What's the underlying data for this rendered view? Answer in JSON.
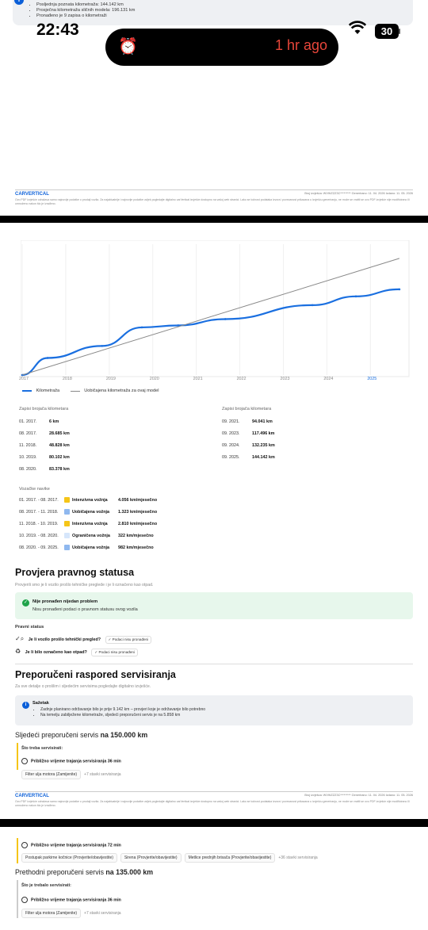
{
  "status_bar": {
    "time": "22:43",
    "activity": "1 hr ago",
    "battery": "30"
  },
  "top_info": {
    "items": [
      "Posljednja poznata kilometraža: 144.142 km",
      "Prosječna kilometraža sličnih modela: 196.131 km",
      "Pronađeno je 9 zapisa o kilometraži"
    ]
  },
  "footer": {
    "logo": "CARVERTICAL",
    "meta": "Broj izvješća: WVWZZZ3C*********     Generirano: 11. 04. 2026     Izdano: 11. 05. 2026",
    "disclaimer": "Ovo PDF izvješće odražava samo najnovije podatke o prodaji vozila. Za najaktualnije i najnovije podatke uvijek pogledajte digitalno carVertical izvješće dostupno na vašoj web stranici. Lako se točnost podataka izvora i povezanost prikazana u izvješću generiranju, ne može se vratiti se ovo PDF izvješće nije modificirano ili umnoženo nakon što je izrađeno."
  },
  "chart_data": {
    "type": "line",
    "x_ticks": [
      "2017",
      "2018",
      "2019",
      "2020",
      "2021",
      "2022",
      "2023",
      "2024",
      "2025"
    ],
    "highlighted_tick": "2025",
    "series": [
      {
        "name": "Kilometraža",
        "color": "#1a6fe0",
        "x": [
          "01. 2017.",
          "08. 2017.",
          "11. 2018.",
          "10. 2019.",
          "08. 2020.",
          "09. 2021.",
          "09. 2023.",
          "09. 2024.",
          "09. 2025."
        ],
        "values": [
          6,
          28685,
          48828,
          80102,
          83378,
          94041,
          117496,
          132235,
          144142
        ]
      },
      {
        "name": "Uobičajena kilometraža za ovaj model",
        "color": "#888888",
        "x": [
          "01. 2017.",
          "09. 2025."
        ],
        "values": [
          0,
          196131
        ]
      }
    ],
    "ylim": [
      0,
      220000
    ]
  },
  "odometer": {
    "title": "Zapisi brojača kilometara",
    "left": [
      {
        "date": "01. 2017.",
        "km": "6 km"
      },
      {
        "date": "08. 2017.",
        "km": "28.685 km"
      },
      {
        "date": "11. 2018.",
        "km": "48.828 km"
      },
      {
        "date": "10. 2019.",
        "km": "80.102 km"
      },
      {
        "date": "08. 2020.",
        "km": "83.378 km"
      }
    ],
    "right": [
      {
        "date": "09. 2021.",
        "km": "94.041 km"
      },
      {
        "date": "09. 2023.",
        "km": "117.496 km"
      },
      {
        "date": "09. 2024.",
        "km": "132.235 km"
      },
      {
        "date": "09. 2025.",
        "km": "144.142 km"
      }
    ]
  },
  "habits": {
    "title": "Vozačke navike",
    "rows": [
      {
        "period": "01. 2017. - 08. 2017.",
        "label": "Intenzivna vožnja",
        "value": "4.056 km/mjesečno",
        "color": "#f5c518"
      },
      {
        "period": "08. 2017. - 11. 2018.",
        "label": "Uobičajena vožnja",
        "value": "1.323 km/mjesečno",
        "color": "#8fb8ef"
      },
      {
        "period": "11. 2018. - 10. 2019.",
        "label": "Intenzivna vožnja",
        "value": "2.810 km/mjesečno",
        "color": "#f5c518"
      },
      {
        "period": "10. 2019. - 08. 2020.",
        "label": "Ograničena vožnja",
        "value": "322 km/mjesečno",
        "color": "#d6e6fb"
      },
      {
        "period": "08. 2020. - 09. 2025.",
        "label": "Uobičajena vožnja",
        "value": "982 km/mjesečno",
        "color": "#8fb8ef"
      }
    ]
  },
  "legal": {
    "title": "Provjera pravnog statusa",
    "subtitle": "Provjerili smo je li vozilo prošlo tehničke preglede i je li označeno kao otpad.",
    "ok_title": "Nije pronađen nijedan problem",
    "ok_text": "Nisu pronađeni podaci o pravnom statusu ovog vozila",
    "status_title": "Pravni status",
    "q1": "Je li vozilo prošlo tehnički pregled?",
    "q2": "Je li bilo označeno kao otpad?",
    "pill": "✓ Podaci nisu pronađeni"
  },
  "service": {
    "title": "Preporučeni raspored servisiranja",
    "subtitle": "Za sve detalje o prošlim i sljedećim servisima pogledajte digitalno izvješće.",
    "summary_title": "Sažetak",
    "summary_items": [
      "Zadnje planirano održavanje bilo je prije 9.142 km – provjeri koje je održavanje bilo potrebno",
      "Na temelju zabilježene kilometraže, sljedeći preporučeni servis je na 5.858 km"
    ],
    "next_prefix": "Sljedeći preporučeni servis ",
    "next_km": "na 150.000 km",
    "todo_title": "Što treba servisirati:",
    "duration1": "Približno vrijeme trajanja servisiranja 36 min",
    "chip1": "Filter ulja motora (Zamijenite)",
    "more1": "+7 stavki servisiranja"
  },
  "page3": {
    "duration": "Približno vrijeme trajanja servisiranja 72 min",
    "chips": [
      "Postupak parkirne kočnice (Provjerite/obavijestite)",
      "Sirena (Provjerite/obavijestite)",
      "Metlice prednjih brisača (Provjerite/obavijestite)"
    ],
    "more": "+36 stavki servisiranja",
    "prev_prefix": "Prethodni preporučeni servis ",
    "prev_km": "na 135.000 km",
    "prev_todo": "Što je trebalo servisirati:",
    "duration2": "Približno vrijeme trajanja servisiranja 36 min",
    "chip2": "Filter ulja motora (Zamijenite)",
    "more2": "+7 stavki servisiranja"
  }
}
